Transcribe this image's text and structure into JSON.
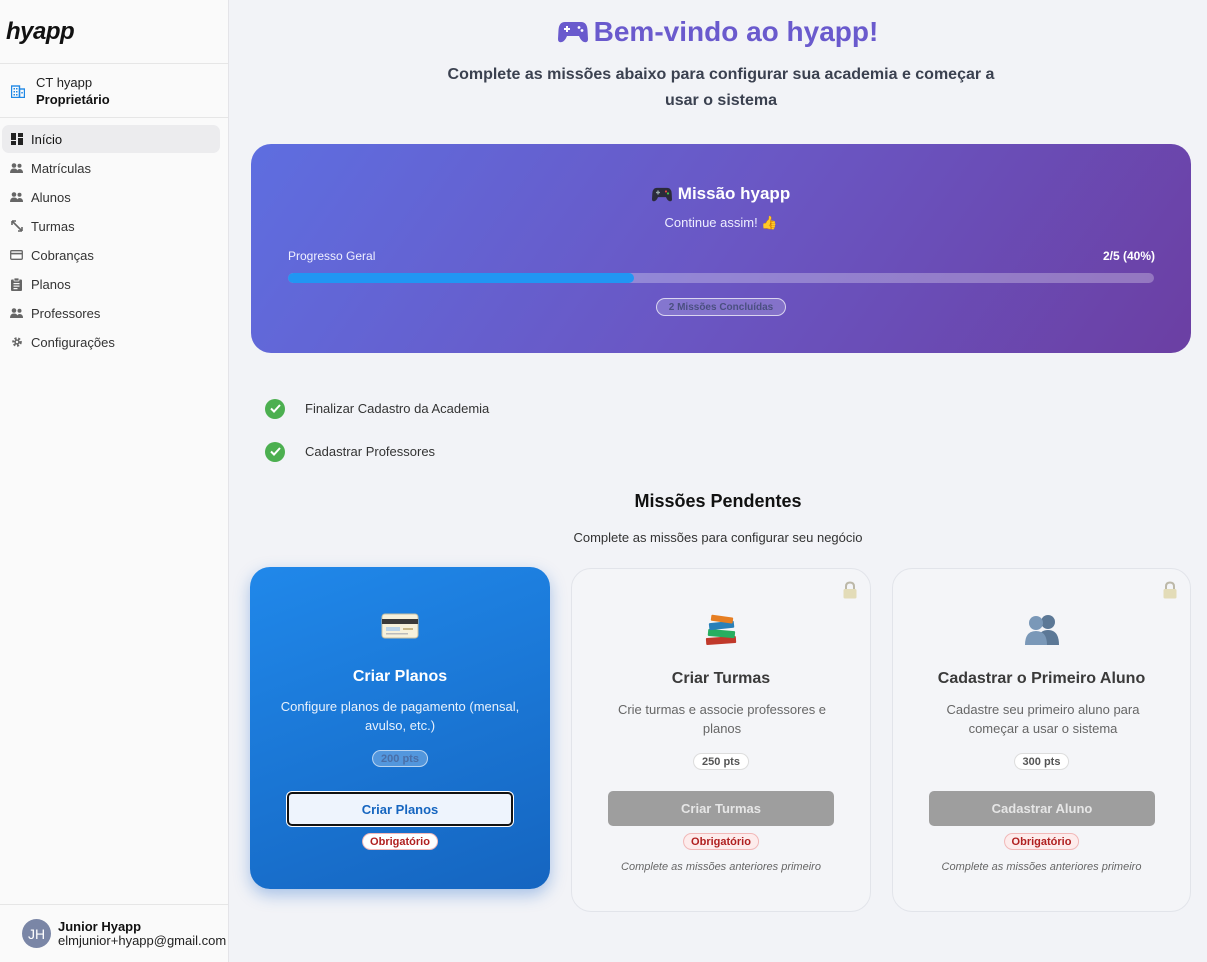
{
  "sidebar": {
    "logo": "hyapp",
    "org": {
      "name": "CT hyapp",
      "role": "Proprietário"
    },
    "nav": [
      {
        "label": "Início",
        "icon": "dashboard-icon",
        "active": true
      },
      {
        "label": "Matrículas",
        "icon": "people-icon"
      },
      {
        "label": "Alunos",
        "icon": "people-icon"
      },
      {
        "label": "Turmas",
        "icon": "swap-icon"
      },
      {
        "label": "Cobranças",
        "icon": "credit-card-icon"
      },
      {
        "label": "Planos",
        "icon": "clipboard-icon"
      },
      {
        "label": "Professores",
        "icon": "people-icon"
      },
      {
        "label": "Configurações",
        "icon": "gear-icon"
      }
    ],
    "user": {
      "initials": "JH",
      "name": "Junior Hyapp",
      "email": "elmjunior+hyapp@gmail.com"
    }
  },
  "header": {
    "title": "Bem-vindo ao hyapp!",
    "subtitle": "Complete as missões abaixo para configurar sua academia e começar a usar o sistema"
  },
  "mission": {
    "title": "Missão hyapp",
    "encouragement": "Continue assim! 👍",
    "progress_label": "Progresso Geral",
    "progress_text": "2/5 (40%)",
    "progress_fraction": 0.4,
    "completed_badge": "2 Missões Concluídas"
  },
  "completed": [
    {
      "label": "Finalizar Cadastro da Academia"
    },
    {
      "label": "Cadastrar Professores"
    }
  ],
  "pending": {
    "title": "Missões Pendentes",
    "subtitle": "Complete as missões para configurar seu negócio",
    "cards": [
      {
        "title": "Criar Planos",
        "description": "Configure planos de pagamento (mensal, avulso, etc.)",
        "points": "200 pts",
        "button": "Criar Planos",
        "required": "Obrigatório",
        "icon": "credit-card-icon",
        "locked": false
      },
      {
        "title": "Criar Turmas",
        "description": "Crie turmas e associe professores e planos",
        "points": "250 pts",
        "button": "Criar Turmas",
        "required": "Obrigatório",
        "note": "Complete as missões anteriores primeiro",
        "icon": "books-icon",
        "locked": true
      },
      {
        "title": "Cadastrar o Primeiro Aluno",
        "description": "Cadastre seu primeiro aluno para começar a usar o sistema",
        "points": "300 pts",
        "button": "Cadastrar Aluno",
        "required": "Obrigatório",
        "note": "Complete as missões anteriores primeiro",
        "icon": "people-icon",
        "locked": true
      }
    ]
  },
  "colors": {
    "accent": "#6a5acd",
    "primary": "#1e88e5",
    "progress": "#2196f3",
    "success": "#4caf50",
    "required": "#b02020"
  }
}
